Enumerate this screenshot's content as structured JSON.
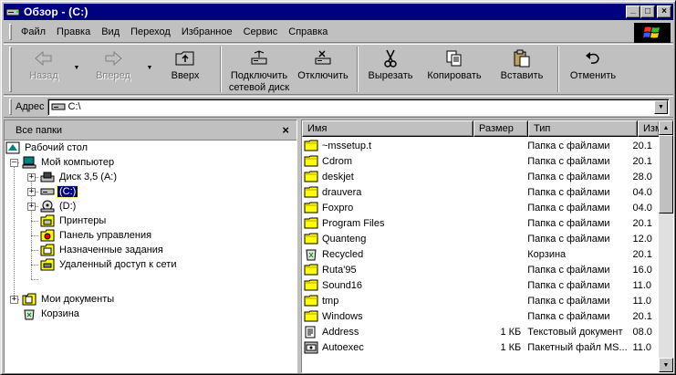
{
  "window": {
    "title": "Обзор - (C:)",
    "controls": {
      "minimize": "_",
      "maximize": "□",
      "close": "×"
    }
  },
  "menu": [
    "Файл",
    "Правка",
    "Вид",
    "Переход",
    "Избранное",
    "Сервис",
    "Справка"
  ],
  "toolbar": {
    "back": "Назад",
    "forward": "Вперед",
    "up": "Вверх",
    "map_drive_line1": "Подключить",
    "map_drive_line2": "сетевой диск",
    "disconnect": "Отключить",
    "cut": "Вырезать",
    "copy": "Копировать",
    "paste": "Вставить",
    "undo": "Отменить"
  },
  "address": {
    "label": "Адрес",
    "value": "C:\\"
  },
  "folders_pane": {
    "title": "Все папки",
    "close": "×",
    "tree": {
      "desktop": "Рабочий стол",
      "my_computer": "Мой компьютер",
      "floppy": "Диск 3,5 (A:)",
      "drive_c": "(C:)",
      "drive_d": "(D:)",
      "printers": "Принтеры",
      "control_panel": "Панель управления",
      "scheduled_tasks": "Назначенные задания",
      "dialup": "Удаленный доступ к сети",
      "my_documents": "Мои документы",
      "recycle_bin": "Корзина"
    }
  },
  "file_list": {
    "columns": {
      "name": "Имя",
      "size": "Размер",
      "type": "Тип",
      "modified": "Изм"
    },
    "rows": [
      {
        "icon": "folder-icon",
        "name": "~mssetup.t",
        "size": "",
        "type": "Папка с файлами",
        "modified": "20.1"
      },
      {
        "icon": "folder-icon",
        "name": "Cdrom",
        "size": "",
        "type": "Папка с файлами",
        "modified": "20.1"
      },
      {
        "icon": "folder-icon",
        "name": "deskjet",
        "size": "",
        "type": "Папка с файлами",
        "modified": "28.0"
      },
      {
        "icon": "folder-icon",
        "name": "drauvera",
        "size": "",
        "type": "Папка с файлами",
        "modified": "04.0"
      },
      {
        "icon": "folder-icon",
        "name": "Foxpro",
        "size": "",
        "type": "Папка с файлами",
        "modified": "04.0"
      },
      {
        "icon": "folder-icon",
        "name": "Program Files",
        "size": "",
        "type": "Папка с файлами",
        "modified": "20.1"
      },
      {
        "icon": "folder-icon",
        "name": "Quanteng",
        "size": "",
        "type": "Папка с файлами",
        "modified": "12.0"
      },
      {
        "icon": "recycle-bin-icon",
        "name": "Recycled",
        "size": "",
        "type": "Корзина",
        "modified": "20.1"
      },
      {
        "icon": "folder-icon",
        "name": "Ruta'95",
        "size": "",
        "type": "Папка с файлами",
        "modified": "16.0"
      },
      {
        "icon": "folder-icon",
        "name": "Sound16",
        "size": "",
        "type": "Папка с файлами",
        "modified": "11.0"
      },
      {
        "icon": "folder-icon",
        "name": "tmp",
        "size": "",
        "type": "Папка с файлами",
        "modified": "11.0"
      },
      {
        "icon": "folder-icon",
        "name": "Windows",
        "size": "",
        "type": "Папка с файлами",
        "modified": "20.1"
      },
      {
        "icon": "text-document-icon",
        "name": "Address",
        "size": "1 КБ",
        "type": "Текстовый документ",
        "modified": "08.0"
      },
      {
        "icon": "batch-file-icon",
        "name": "Autoexec",
        "size": "1 КБ",
        "type": "Пакетный файл MS...",
        "modified": "11.0"
      }
    ]
  },
  "colors": {
    "titlebar": "#000080",
    "face": "#c0c0c0",
    "selection": "#000080",
    "folder": "#ffff00"
  }
}
